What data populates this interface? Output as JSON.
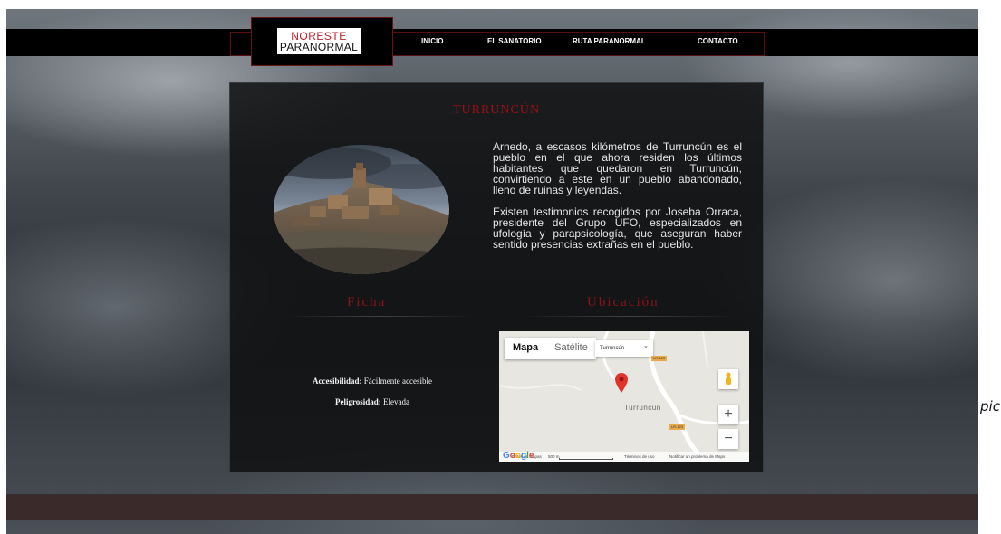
{
  "brand": {
    "line1": "NORESTE",
    "line2": "PARANORMAL"
  },
  "nav": [
    {
      "label": "INICIO"
    },
    {
      "label": "EL SANATORIO"
    },
    {
      "label": "RUTA PARANORMAL"
    },
    {
      "label": "CONTACTO"
    }
  ],
  "page": {
    "title": "TURRUNCÚN",
    "paragraphs": [
      "Arnedo, a escasos kilómetros de Turruncún es el pueblo en el que ahora residen los últimos habitantes que quedaron en Turruncún, convirtiendo a este en un pueblo abandonado, lleno de ruinas y leyendas.",
      "Existen testimonios recogidos por Joseba Orraca, presidente del Grupo UFO, especializados en ufología y parapsicología, que aseguran haber sentido presencias extrañas en el pueblo."
    ]
  },
  "ficha": {
    "title": "Ficha",
    "accesibilidad_label": "Accesibilidad:",
    "accesibilidad_value": "Fácilmente accesible",
    "peligrosidad_label": "Peligrosidad:",
    "peligrosidad_value": "Elevada"
  },
  "ubicacion": {
    "title": "Ubicación",
    "map": {
      "tab_map": "Mapa",
      "tab_satellite": "Satélite",
      "tooltip": "Turruncún",
      "tooltip_close": "×",
      "place_label": "Turruncún",
      "road_1": "LR-123",
      "road_2": "LR-123",
      "zoom_in": "+",
      "zoom_out": "−",
      "google": "Google",
      "footer_data": "Datos de mapas",
      "footer_scale": "500 m",
      "footer_terms": "Términos de uso",
      "footer_report": "Notificar un problema de Maps"
    }
  },
  "cutoff_text": "pic",
  "colors": {
    "accent": "#9a1015",
    "nav_bg": "#000000",
    "panel_bg": "#0f1012",
    "footer_bg": "#3a2b2a"
  }
}
